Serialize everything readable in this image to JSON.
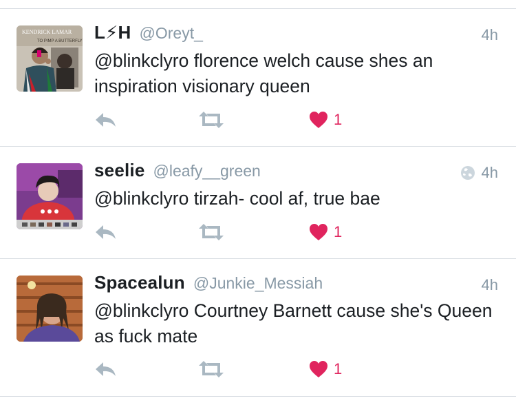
{
  "tweets": [
    {
      "name": "L⚡H",
      "handle": "@Oreyt_",
      "time": "4h",
      "text": "@blinkclyro florence welch cause shes an inspiration visionary queen",
      "likes": "1",
      "has_globe": false,
      "avatar_icon": "poster-photo"
    },
    {
      "name": "seelie",
      "handle": "@leafy__green",
      "time": "4h",
      "text": "@blinkclyro tirzah- cool af, true bae",
      "likes": "1",
      "has_globe": true,
      "avatar_icon": "selfie-photo"
    },
    {
      "name": "Spacealun",
      "handle": "@Junkie_Messiah",
      "time": "4h",
      "text": "@blinkclyro Courtney Barnett cause she's Queen as fuck mate",
      "likes": "1",
      "has_globe": false,
      "avatar_icon": "dreadlocks-photo"
    }
  ],
  "avatar_text": {
    "poster_top": "KENDRICK LAMAR",
    "poster_sub": "TO PIMP A BUTTERFLY"
  },
  "colors": {
    "like": "#e0245e",
    "muted": "#8899a6",
    "icon": "#aab8c2",
    "divider": "#d8dde2"
  }
}
